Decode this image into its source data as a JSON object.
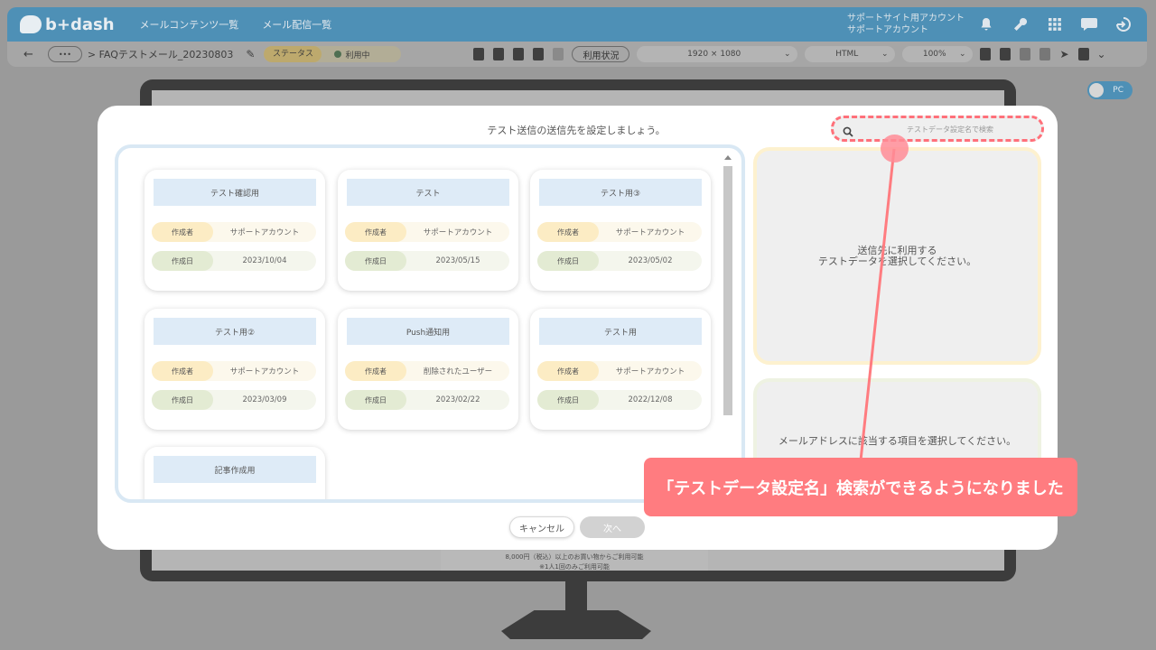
{
  "app": {
    "logo": "b+dash",
    "nav": [
      "メールコンテンツ一覧",
      "メール配信一覧"
    ],
    "account": [
      "サポートサイト用アカウント",
      "サポートアカウント"
    ]
  },
  "subbar": {
    "more": "•••",
    "breadcrumb": "> FAQテストメール_20230803",
    "status_label": "ステータス",
    "status_value": "利用中",
    "usage": "利用状況",
    "resolution": "1920 × 1080",
    "format": "HTML",
    "zoom": "100%"
  },
  "view_toggle": "PC",
  "background_notes": [
    "8,000円（税込）以上のお買い物からご利用可能",
    "※1人1回のみご利用可能"
  ],
  "modal": {
    "title": "テスト送信の送信先を設定しましょう。",
    "search_placeholder": "テストデータ設定名で検索",
    "author_label": "作成者",
    "date_label": "作成日",
    "cards": [
      {
        "name": "テスト確認用",
        "author": "サポートアカウント",
        "date": "2023/10/04"
      },
      {
        "name": "テスト",
        "author": "サポートアカウント",
        "date": "2023/05/15"
      },
      {
        "name": "テスト用③",
        "author": "サポートアカウント",
        "date": "2023/05/02"
      },
      {
        "name": "テスト用②",
        "author": "サポートアカウント",
        "date": "2023/03/09"
      },
      {
        "name": "Push通知用",
        "author": "削除されたユーザー",
        "date": "2023/02/22"
      },
      {
        "name": "テスト用",
        "author": "サポートアカウント",
        "date": "2022/12/08"
      },
      {
        "name": "記事作成用",
        "author": "",
        "date": ""
      }
    ],
    "select_prompt_line1": "送信先に利用する",
    "select_prompt_line2": "テストデータを選択してください。",
    "field_prompt": "メールアドレスに該当する項目を選択してください。",
    "cancel": "キャンセル",
    "next": "次へ"
  },
  "callout": "「テストデータ設定名」検索ができるようになりました",
  "colors": {
    "brand": "#4e90b6",
    "accent": "#ff7c80",
    "card_header": "#deebf7",
    "author_tag": "#fcecc4",
    "date_tag": "#e3ebd3"
  }
}
